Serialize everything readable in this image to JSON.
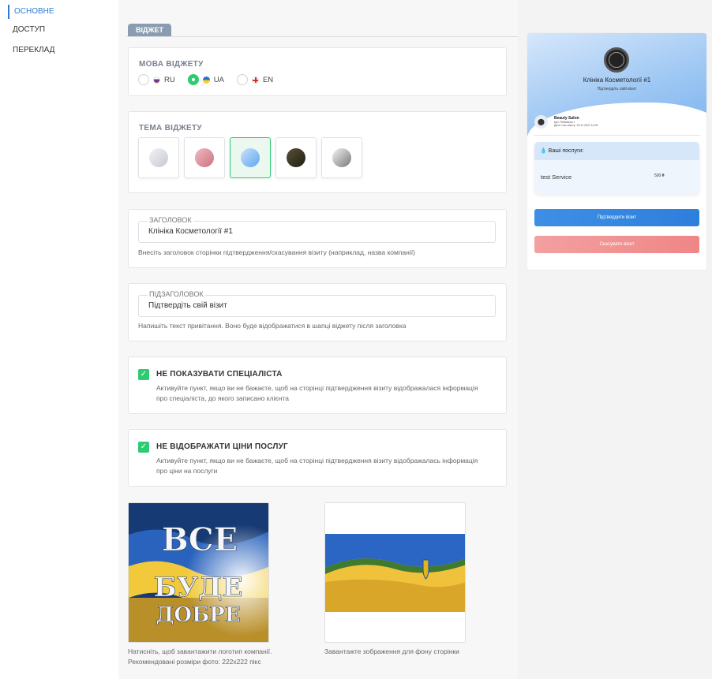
{
  "sidebar": {
    "items": [
      {
        "label": "ОСНОВНЕ",
        "active": true
      },
      {
        "label": "ДОСТУП",
        "active": false
      },
      {
        "label": "ПЕРЕКЛАД",
        "active": false
      }
    ]
  },
  "tab": {
    "label": "ВІДЖЕТ"
  },
  "language": {
    "title": "МОВА ВІДЖЕТУ",
    "options": [
      {
        "code": "RU",
        "label": "RU",
        "selected": false
      },
      {
        "code": "UA",
        "label": "UA",
        "selected": true
      },
      {
        "code": "EN",
        "label": "EN",
        "selected": false
      }
    ]
  },
  "theme": {
    "title": "ТЕМА ВІДЖЕТУ",
    "options": [
      {
        "name": "gray",
        "gradient": [
          "#f2f3f5",
          "#c5c9cf"
        ],
        "selected": false
      },
      {
        "name": "pink",
        "gradient": [
          "#f2b9c2",
          "#c9747f"
        ],
        "selected": false
      },
      {
        "name": "blue",
        "gradient": [
          "#c9e2fb",
          "#5fa6ef"
        ],
        "selected": true
      },
      {
        "name": "olive",
        "gradient": [
          "#5a5238",
          "#1f1d12"
        ],
        "selected": false
      },
      {
        "name": "silver",
        "gradient": [
          "#f5f5f5",
          "#777777"
        ],
        "selected": false
      }
    ]
  },
  "header_field": {
    "label": "ЗАГОЛОВОК",
    "value": "Клініка Косметології #1",
    "hint": "Внесіть заголовок сторінки підтвердження/скасування візиту (наприклад, назва компанії)"
  },
  "subheader_field": {
    "label": "ПІДЗАГОЛОВОК",
    "value": "Підтвердіть свій візит",
    "hint": "Напишіть текст привітання. Воно буде відображатися в шапці віджету після заголовка"
  },
  "hide_specialist": {
    "checked": true,
    "title": "НЕ ПОКАЗУВАТИ СПЕЦІАЛІСТА",
    "hint": "Активуйте пункт, якщо ви не бажаєте, щоб на сторінці підтвердження візиту відображалася інформація про спеціаліста, до якого записано клієнта"
  },
  "hide_prices": {
    "checked": true,
    "title": "НЕ ВІДОБРАЖАТИ ЦІНИ ПОСЛУГ",
    "hint": "Активуйте пункт, якщо ви не бажаєте, щоб на сторінці підтвердження візиту відображалась інформація про ціни на послуги"
  },
  "logo_upload": {
    "image_text": [
      "ВСЕ",
      "БУДЕ",
      "ДОБРЕ"
    ],
    "caption_line1": "Натисніть, щоб завантажити логотип компанії.",
    "caption_line2": "Рекомендовані розміри фото: 222x222 пікс"
  },
  "bg_upload": {
    "caption": "Завантажте зображення для фону сторінки"
  },
  "preview": {
    "title": "Клініка Косметології #1",
    "subtitle": "Підтвердіть свій візит",
    "salon_name": "Beauty Salon",
    "address": "вул. Пейзажна 1",
    "date": "Дата і час візиту: 25.11.2021 10:00",
    "services_title": "Ваші послуги:",
    "service_name": "test Service",
    "service_price": "500 ₴",
    "confirm_button": "Підтвердити візит",
    "cancel_button": "Скасувати візит"
  }
}
